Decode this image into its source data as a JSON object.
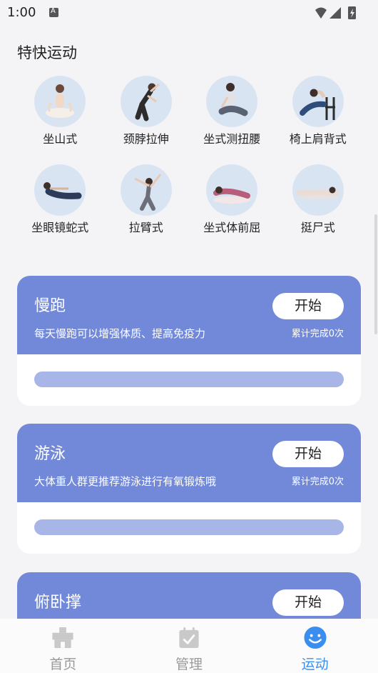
{
  "status_bar": {
    "time": "1:00"
  },
  "section_title": "特快运动",
  "poses": [
    {
      "label": "坐山式",
      "icon": "seated-mountain-pose-icon"
    },
    {
      "label": "颈脖拉伸",
      "icon": "neck-stretch-pose-icon"
    },
    {
      "label": "坐式测扭腰",
      "icon": "seated-twist-pose-icon"
    },
    {
      "label": "椅上肩背式",
      "icon": "chair-backbend-pose-icon"
    },
    {
      "label": "坐眼镜蛇式",
      "icon": "cobra-pose-icon"
    },
    {
      "label": "拉臂式",
      "icon": "arm-stretch-pose-icon"
    },
    {
      "label": "坐式体前屈",
      "icon": "seated-forward-bend-pose-icon"
    },
    {
      "label": "挺尸式",
      "icon": "corpse-pose-icon"
    }
  ],
  "sports": [
    {
      "name": "慢跑",
      "description": "每天慢跑可以增强体质、提高免疫力",
      "count_text": "累计完成0次",
      "button": "开始",
      "progress": 0
    },
    {
      "name": "游泳",
      "description": "大体重人群更推荐游泳进行有氧锻炼哦",
      "count_text": "累计完成0次",
      "button": "开始",
      "progress": 0
    },
    {
      "name": "俯卧撑",
      "button": "开始"
    }
  ],
  "bottom_nav": [
    {
      "label": "首页",
      "icon": "home-icon",
      "active": false
    },
    {
      "label": "管理",
      "icon": "clipboard-check-icon",
      "active": false
    },
    {
      "label": "运动",
      "icon": "smiley-icon",
      "active": true
    }
  ],
  "colors": {
    "card_header": "#7289d9",
    "progress_track": "#a7b6e6",
    "active_tab": "#3a8ef0",
    "inactive_tab": "#999999",
    "pose_circle": "#d9e4f3"
  }
}
